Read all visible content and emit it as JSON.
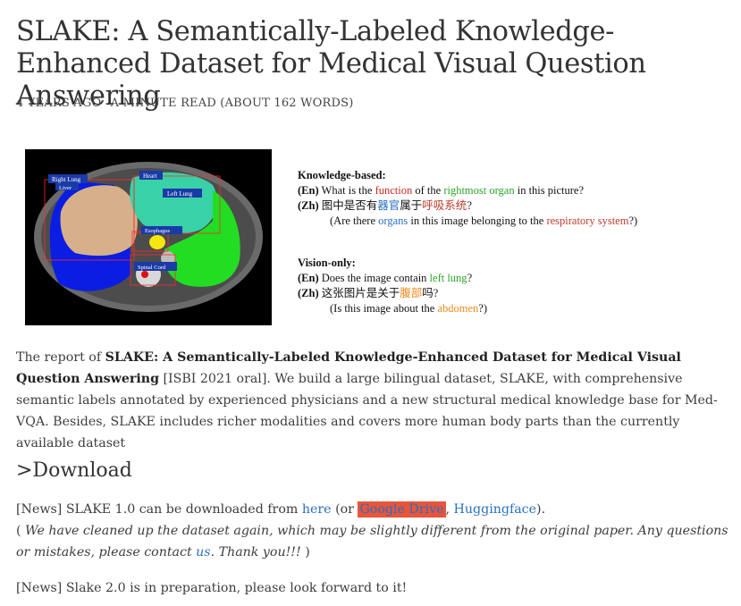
{
  "title": "SLAKE: A Semantically-Labeled Knowledge-Enhanced Dataset for Medical Visual Question Answering",
  "meta": {
    "posted": "4 YEARS AGO",
    "read_time": "A MINUTE READ (ABOUT 162 WORDS)"
  },
  "figure": {
    "labels": {
      "right_lung": "Right Lung",
      "liver": "Liver",
      "heart": "Heart",
      "left_lung": "Left Lung",
      "esophagus": "Esophagus",
      "spinal_cord": "Spinal Cord"
    },
    "knowledge_header": "Knowledge-based:",
    "vision_header": "Vision-only:",
    "tag_en": "(En)",
    "tag_zh": "(Zh)",
    "kb_en": {
      "t1": " What is the ",
      "t2": "function",
      "t3": " of the ",
      "t4": "rightmost organ",
      "t5": " in this picture?"
    },
    "kb_zh": {
      "t1": " 图中是否有",
      "t2": "器官",
      "t3": "属于",
      "t4": "呼吸系统",
      "t5": "?"
    },
    "kb_zh_tr": {
      "t1": "(Are there ",
      "t2": "organs",
      "t3": " in this image belonging to the ",
      "t4": "respiratory system",
      "t5": "?)"
    },
    "vo_en": {
      "t1": " Does the image contain ",
      "t2": "left lung",
      "t3": "?"
    },
    "vo_zh": {
      "t1": " 这张图片是关于",
      "t2": "腹部",
      "t3": "吗?"
    },
    "vo_zh_tr": {
      "t1": "(Is this image about the ",
      "t2": "abdomen",
      "t3": "?)"
    }
  },
  "report": {
    "lead": "The report of ",
    "bold_title": "SLAKE: A Semantically-Labeled Knowledge-Enhanced Dataset for Medical Visual Question Answering",
    "rest": " [ISBI 2021 oral]. We build a large bilingual dataset, SLAKE, with comprehensive semantic labels annotated by experienced physicians and a new structural medical knowledge base for Med-VQA. Besides, SLAKE includes richer modalities and covers more human body parts than the currently available dataset"
  },
  "download_heading": ">Download",
  "news1": {
    "lead": "[News] SLAKE 1.0 can be downloaded from ",
    "here": "here",
    "mid": " (or ",
    "gdrive": "Google Drive",
    "comma": ", ",
    "hf": "Huggingface",
    "end": ").",
    "note_open": "( ",
    "note_text": "We have cleaned up the dataset again, which may be slightly different from the original paper. Any questions or mistakes, please contact ",
    "us": "us",
    "note_end": ". Thank you!!!",
    "note_close": " )"
  },
  "news2": "[News] Slake 2.0 is in preparation, please look forward to it!",
  "colors": {
    "link": "#2a6fc2",
    "highlight": "#e8553a"
  }
}
